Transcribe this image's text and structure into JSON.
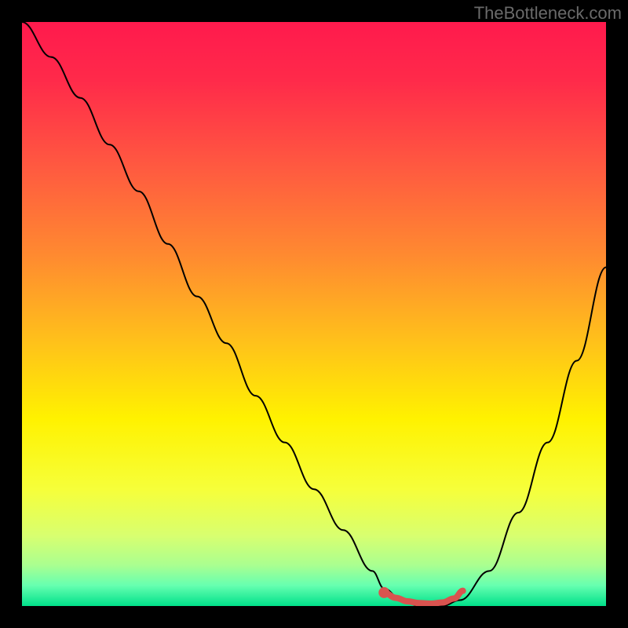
{
  "watermark": "TheBottleneck.com",
  "chart_data": {
    "type": "line",
    "title": "",
    "xlabel": "",
    "ylabel": "",
    "xlim": [
      0,
      100
    ],
    "ylim": [
      0,
      100
    ],
    "grid": false,
    "series": [
      {
        "name": "bottleneck-curve",
        "x": [
          0,
          5,
          10,
          15,
          20,
          25,
          30,
          35,
          40,
          45,
          50,
          55,
          60,
          62,
          65,
          68,
          72,
          75,
          80,
          85,
          90,
          95,
          100
        ],
        "y": [
          100,
          94,
          87,
          79,
          71,
          62,
          53,
          45,
          36,
          28,
          20,
          13,
          6,
          3,
          1,
          0,
          0,
          1,
          6,
          16,
          28,
          42,
          58
        ],
        "color": "#000000",
        "stroke_width": 2
      },
      {
        "name": "optimal-marker",
        "x": [
          62,
          64,
          66,
          68,
          70,
          72,
          74,
          75.5
        ],
        "y": [
          2.3,
          1.4,
          0.8,
          0.5,
          0.4,
          0.6,
          1.3,
          2.6
        ],
        "color": "#d9534f",
        "stroke_width": 8,
        "marker_start": true
      }
    ],
    "gradient_stops": [
      {
        "pos": 0.0,
        "color": "#ff1a4d"
      },
      {
        "pos": 0.1,
        "color": "#ff2a4a"
      },
      {
        "pos": 0.25,
        "color": "#ff5a40"
      },
      {
        "pos": 0.4,
        "color": "#ff8a30"
      },
      {
        "pos": 0.55,
        "color": "#ffc21a"
      },
      {
        "pos": 0.68,
        "color": "#fff200"
      },
      {
        "pos": 0.8,
        "color": "#f6ff3a"
      },
      {
        "pos": 0.88,
        "color": "#d8ff70"
      },
      {
        "pos": 0.93,
        "color": "#aaff90"
      },
      {
        "pos": 0.965,
        "color": "#66ffb0"
      },
      {
        "pos": 1.0,
        "color": "#00e08a"
      }
    ]
  }
}
